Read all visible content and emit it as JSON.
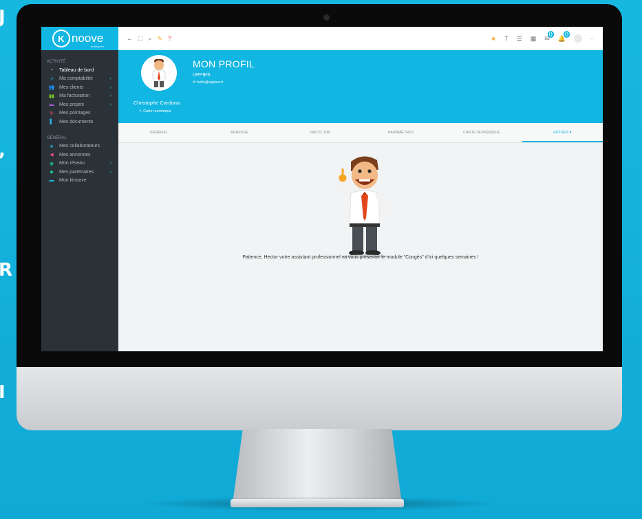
{
  "app": {
    "logo_letter": "K",
    "logo_text": "noove",
    "logo_sub": "entreprise"
  },
  "sidebar": {
    "section_activity": "ACTIVITÉ",
    "activity_items": [
      {
        "label": "Tableau de bord",
        "icon": "dashboard-icon",
        "glyph": "◔",
        "color": "#ffffff",
        "active": true,
        "arrow": false
      },
      {
        "label": "Ma comptabilité",
        "icon": "chart-icon",
        "glyph": "↗",
        "color": "#27b7e9",
        "active": false,
        "arrow": true
      },
      {
        "label": "Mes clients",
        "icon": "users-icon",
        "glyph": "👥",
        "color": "#6c6ef0",
        "active": false,
        "arrow": true
      },
      {
        "label": "Ma facturation",
        "icon": "invoice-icon",
        "glyph": "▮▮",
        "color": "#7ed321",
        "active": false,
        "arrow": true
      },
      {
        "label": "Mes projets",
        "icon": "briefcase-icon",
        "glyph": "▬",
        "color": "#a55bd6",
        "active": false,
        "arrow": true
      },
      {
        "label": "Mes pointages",
        "icon": "sync-icon",
        "glyph": "↻",
        "color": "#ef4c5a",
        "active": false,
        "arrow": false
      },
      {
        "label": "Mes documents",
        "icon": "document-icon",
        "glyph": "▌",
        "color": "#27b7e9",
        "active": false,
        "arrow": false
      }
    ],
    "section_general": "GÉNÉRAL",
    "general_items": [
      {
        "label": "Mes collaborateurs",
        "icon": "star-icon",
        "glyph": "★",
        "color": "#27b7e9",
        "arrow": false
      },
      {
        "label": "Mes annonces",
        "icon": "megaphone-icon",
        "glyph": "◀",
        "color": "#ef4c8a",
        "arrow": false
      },
      {
        "label": "Mon réseau",
        "icon": "network-icon",
        "glyph": "◉",
        "color": "#1fc48f",
        "arrow": true
      },
      {
        "label": "Mes partenaires",
        "icon": "handshake-icon",
        "glyph": "◆",
        "color": "#1fc48f",
        "arrow": true
      },
      {
        "label": "Mon kinoove",
        "icon": "cart-icon",
        "glyph": "▬",
        "color": "#27b7e9",
        "arrow": false
      }
    ]
  },
  "topbar": {
    "left_icons": [
      {
        "name": "back-arrow-icon",
        "glyph": "←",
        "color": "#666666"
      },
      {
        "name": "fullscreen-icon",
        "glyph": "⛶",
        "color": "#777777"
      },
      {
        "name": "search-icon",
        "glyph": "⌕",
        "color": "#777777"
      },
      {
        "name": "magic-wand-icon",
        "glyph": "✎",
        "color": "#f5a623"
      },
      {
        "name": "help-icon",
        "glyph": "?",
        "color": "#ef4c5a"
      }
    ],
    "right_icons": [
      {
        "name": "star-icon",
        "glyph": "★",
        "color": "#f5a623",
        "badge": ""
      },
      {
        "name": "text-size-icon",
        "glyph": "T",
        "color": "#777777",
        "badge": ""
      },
      {
        "name": "list-icon",
        "glyph": "☰",
        "color": "#777777",
        "badge": ""
      },
      {
        "name": "calendar-icon",
        "glyph": "▦",
        "color": "#777777",
        "badge": ""
      },
      {
        "name": "chat-icon",
        "glyph": "✉",
        "color": "#777777",
        "badge": "0"
      },
      {
        "name": "notification-bell-icon",
        "glyph": "🔔",
        "color": "#777777",
        "badge": "0"
      }
    ],
    "more": "···"
  },
  "profile": {
    "name": "Christophe Cardona",
    "card_link": "Carte numérique",
    "title": "MON PROFIL",
    "company": "UPPIES",
    "email": "hello@uppies.fr"
  },
  "tabs": [
    "GÉNÉRAL",
    "ADRESSE",
    "INFOS JOB",
    "PARAMÈTRES",
    "CARTE NUMÉRIQUE",
    "AUTRES ▾"
  ],
  "active_tab": 5,
  "content": {
    "message": "Patience, Hector votre assistant professionnel va vous présenter le module \"Congés\" d'ici quelques semaines !"
  },
  "colors": {
    "brand": "#12b6e2",
    "sidebar": "#2a3137",
    "accent_orange": "#f5a623"
  }
}
